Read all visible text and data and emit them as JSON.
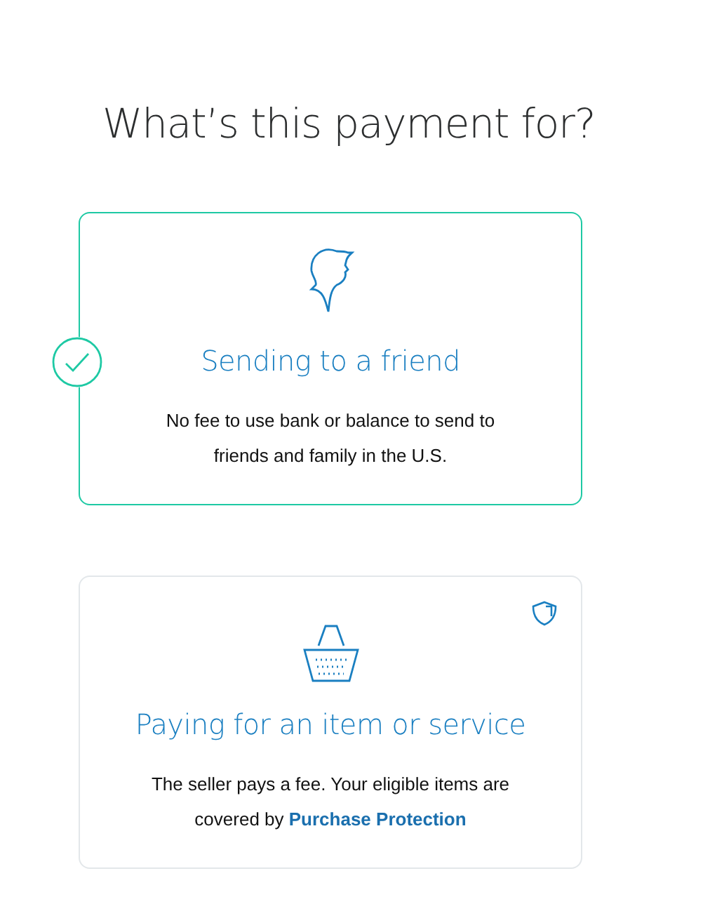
{
  "title": "What’s this payment for?",
  "options": [
    {
      "kind": "friend",
      "selected": true,
      "title": "Sending to a friend",
      "description": "No fee to use bank or balance to send to friends and family in the U.S."
    },
    {
      "kind": "goods",
      "selected": false,
      "title": "Paying for an item or service",
      "description": "The seller pays a fee. Your eligible items are covered by ",
      "link": "Purchase Protection"
    }
  ]
}
